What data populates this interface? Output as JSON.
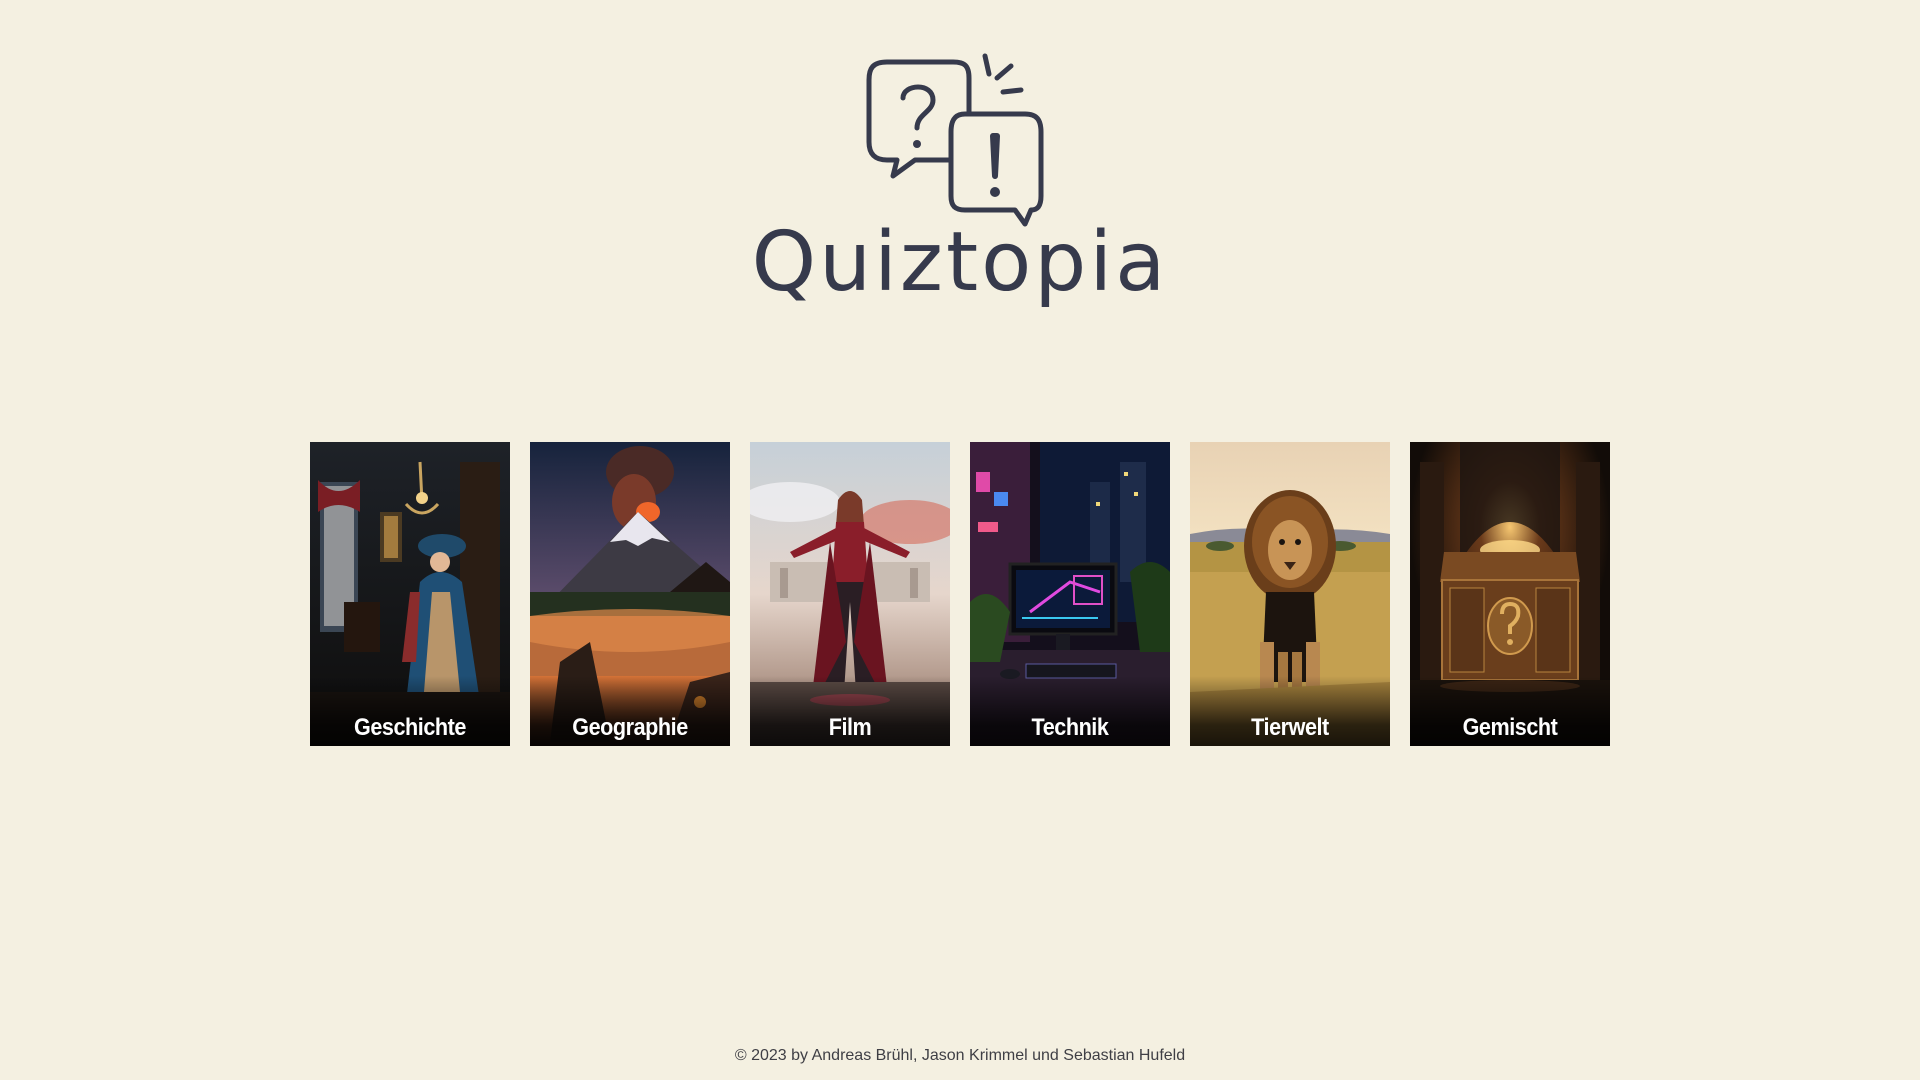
{
  "brand": {
    "name": "Quiztopia",
    "logo_icon": "speech-bubbles-question-exclamation-icon",
    "ink_color": "#363a4c",
    "background_color": "#f4f0e1"
  },
  "categories": [
    {
      "label": "Geschichte",
      "image": "historic-lady-portrait"
    },
    {
      "label": "Geographie",
      "image": "volcano-lake-sunset"
    },
    {
      "label": "Film",
      "image": "superhero-in-red"
    },
    {
      "label": "Technik",
      "image": "neon-computer-desk"
    },
    {
      "label": "Tierwelt",
      "image": "lion-savanna"
    },
    {
      "label": "Gemischt",
      "image": "mystery-treasure-chest"
    }
  ],
  "footer": {
    "text": "© 2023 by Andreas Brühl, Jason Krimmel und Sebastian Hufeld"
  }
}
